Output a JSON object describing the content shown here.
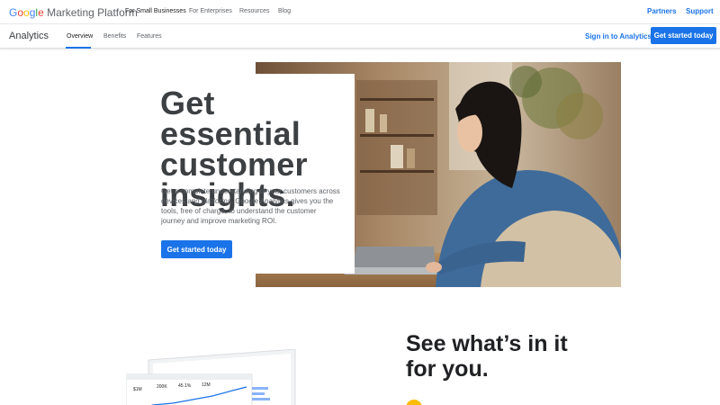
{
  "topnav": {
    "logo_google": [
      "G",
      "o",
      "o",
      "g",
      "l",
      "e"
    ],
    "logo_product": "Marketing Platform",
    "links": [
      "For Small Businesses",
      "For Enterprises",
      "Resources",
      "Blog"
    ],
    "right_links": [
      "Partners",
      "Support"
    ]
  },
  "subnav": {
    "product": "Analytics",
    "tabs": [
      "Overview",
      "Benefits",
      "Features"
    ],
    "signin": "Sign in to Analytics",
    "cta": "Get started today"
  },
  "hero": {
    "title_lines": [
      "Get essential",
      "customer",
      "insights."
    ],
    "description": "Get a complete understanding of your customers across devices and platforms. Google Analytics gives you the tools, free of charge, to understand the customer journey and improve marketing ROI.",
    "cta": "Get started today"
  },
  "section2": {
    "title_lines": [
      "See what’s in it",
      "for you."
    ]
  },
  "laptop_screen": {
    "values": [
      "$1M",
      "200K",
      "45.1%",
      "12M"
    ]
  },
  "colors": {
    "accent": "#1a73e8",
    "google_blue": "#4285f4",
    "google_red": "#ea4335",
    "google_yellow": "#fbbc05",
    "google_green": "#34a853"
  }
}
